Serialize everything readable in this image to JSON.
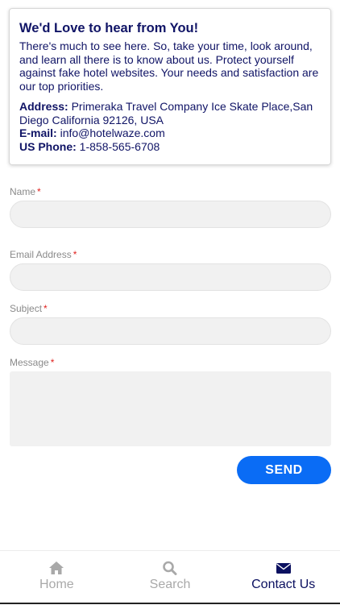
{
  "info_card": {
    "title": "We'd Love to hear from You!",
    "intro": "There's much to see here. So, take your time, look around, and learn all there is to know about us. Protect yourself against fake hotel websites. Your needs and satisfaction are our top priorities.",
    "address_label": "Address:",
    "address_value": "Primeraka Travel Company Ice Skate Place,San Diego California 92126, USA",
    "email_label": "E-mail:",
    "email_value": "info@hotelwaze.com",
    "phone_label": "US Phone:",
    "phone_value": "1-858-565-6708"
  },
  "form": {
    "required_mark": "*",
    "name_label": "Name",
    "email_label": "Email Address",
    "subject_label": "Subject",
    "message_label": "Message",
    "name_value": "",
    "email_value": "",
    "subject_value": "",
    "message_value": "",
    "send_label": "SEND"
  },
  "tabbar": {
    "tabs": [
      {
        "label": "Home",
        "icon": "home-icon"
      },
      {
        "label": "Search",
        "icon": "search-icon"
      },
      {
        "label": "Contact Us",
        "icon": "envelope-icon"
      }
    ],
    "active": "Contact Us"
  },
  "colors": {
    "accent": "#0a6cf5",
    "text_dark": "#101466",
    "required": "#e0221f",
    "tab_inactive": "#a9a9a9",
    "tab_active": "#0b1060"
  }
}
